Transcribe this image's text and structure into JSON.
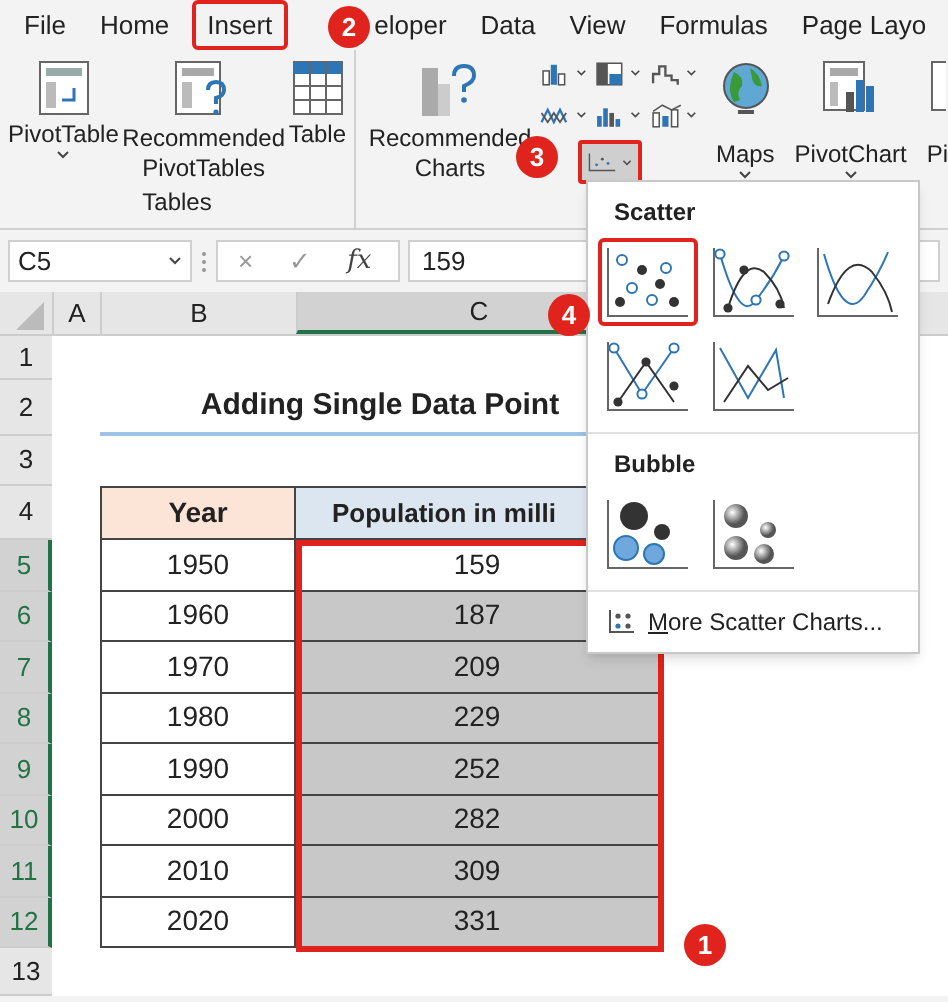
{
  "ribbon_tabs": [
    {
      "label": "File",
      "highlighted": false
    },
    {
      "label": "Home",
      "highlighted": false
    },
    {
      "label": "Insert",
      "highlighted": true
    },
    {
      "label": "eloper",
      "highlighted": false
    },
    {
      "label": "Data",
      "highlighted": false
    },
    {
      "label": "View",
      "highlighted": false
    },
    {
      "label": "Formulas",
      "highlighted": false
    },
    {
      "label": "Page Layo",
      "highlighted": false
    }
  ],
  "tables_group": {
    "label": "Tables",
    "buttons": [
      {
        "label": "PivotTable",
        "caret": true
      },
      {
        "label": "Recommended PivotTables",
        "caret": false
      },
      {
        "label": "Table",
        "caret": false
      }
    ]
  },
  "charts_group": {
    "recommended": {
      "label": "Recommended Charts"
    },
    "scatter_button": {
      "highlighted": true
    },
    "buttons": [
      {
        "label": "Maps",
        "caret": true
      },
      {
        "label": "PivotChart",
        "caret": true
      },
      {
        "label": "Pi",
        "caret": false
      }
    ]
  },
  "formula_bar": {
    "name_box": "C5",
    "cancel": "×",
    "enter": "✓",
    "fx": "fx",
    "value": "159"
  },
  "column_headers": [
    {
      "label": "A",
      "selected": false
    },
    {
      "label": "B",
      "selected": false
    },
    {
      "label": "C",
      "selected": true
    }
  ],
  "title": "Adding Single Data Point",
  "table": {
    "columns": [
      "Year",
      "Population in milli"
    ],
    "rows": [
      {
        "year": "1950",
        "population": "159",
        "shaded": false
      },
      {
        "year": "1960",
        "population": "187",
        "shaded": true
      },
      {
        "year": "1970",
        "population": "209",
        "shaded": true
      },
      {
        "year": "1980",
        "population": "229",
        "shaded": true
      },
      {
        "year": "1990",
        "population": "252",
        "shaded": true
      },
      {
        "year": "2000",
        "population": "282",
        "shaded": true
      },
      {
        "year": "2010",
        "population": "309",
        "shaded": true
      },
      {
        "year": "2020",
        "population": "331",
        "shaded": true
      }
    ]
  },
  "row_headers": [
    {
      "label": "1",
      "selected": false
    },
    {
      "label": "2",
      "selected": false
    },
    {
      "label": "3",
      "selected": false
    },
    {
      "label": "4",
      "selected": false
    },
    {
      "label": "5",
      "selected": true
    },
    {
      "label": "6",
      "selected": true
    },
    {
      "label": "7",
      "selected": true
    },
    {
      "label": "8",
      "selected": true
    },
    {
      "label": "9",
      "selected": true
    },
    {
      "label": "10",
      "selected": true
    },
    {
      "label": "11",
      "selected": true
    },
    {
      "label": "12",
      "selected": true
    },
    {
      "label": "13",
      "selected": false
    }
  ],
  "dropdown": {
    "sections": [
      {
        "heading": "Scatter",
        "items": [
          {
            "kind": "markers",
            "selected": true
          },
          {
            "kind": "smooth-markers",
            "selected": false
          },
          {
            "kind": "smooth",
            "selected": false
          },
          {
            "kind": "straight-markers",
            "selected": false
          },
          {
            "kind": "straight",
            "selected": false
          }
        ]
      },
      {
        "heading": "Bubble",
        "items": [
          {
            "kind": "bubble",
            "selected": false
          },
          {
            "kind": "bubble3d",
            "selected": false
          }
        ]
      }
    ],
    "more": "More Scatter Charts..."
  },
  "callouts": [
    "2",
    "3",
    "4",
    "1"
  ]
}
